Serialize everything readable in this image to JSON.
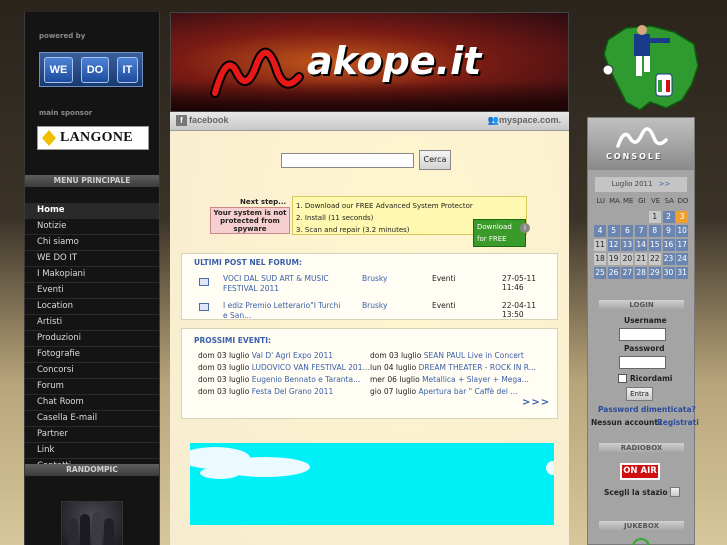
{
  "left": {
    "powered_by": "powered by",
    "wedoit": [
      "WE",
      "DO",
      "IT"
    ],
    "main_sponsor": "main sponsor",
    "sponsor_name": "LANGONE",
    "menu_title": "MENU PRINCIPALE",
    "menu": [
      "Home",
      "Notizie",
      "Chi siamo",
      "WE DO IT",
      "I Makopiani",
      "Eventi",
      "Location",
      "Artisti",
      "Produzioni",
      "Fotografie",
      "Concorsi",
      "Forum",
      "Chat Room",
      "Casella E-mail",
      "Partner",
      "Link",
      "Contatti"
    ],
    "randompic_title": "RANDOMPIC"
  },
  "banner": {
    "logo_text": "akope.it"
  },
  "social": {
    "facebook": "facebook",
    "myspace": "myspace.com."
  },
  "search": {
    "button": "Cerca",
    "value": ""
  },
  "ad": {
    "next_step": "Next step...",
    "warning": "Your system is not protected from spyware",
    "steps": [
      "1. Download our FREE Advanced System Protector",
      "2. Install (11 seconds)",
      "3. Scan and repair (3.2 minutes)"
    ],
    "download": "Download for FREE",
    "info": "i"
  },
  "forum": {
    "title": "ULTIMI POST NEL FORUM:",
    "rows": [
      {
        "title": "VOCI DAL SUD ART & MUSIC FESTIVAL 2011",
        "user": "Brusky",
        "category": "Eventi",
        "date": "27-05-11 11:46"
      },
      {
        "title": "I ediz Premio Letterario\"I Turchi e San...",
        "user": "Brusky",
        "category": "Eventi",
        "date": "22-04-11 13:50"
      }
    ]
  },
  "events": {
    "title": "PROSSIMI EVENTI:",
    "left": [
      {
        "date": "dom 03 luglio",
        "title": "Val D' Agri Expo 2011"
      },
      {
        "date": "dom 03 luglio",
        "title": "LUDOVICO VAN FESTIVAL 201..."
      },
      {
        "date": "dom 03 luglio",
        "title": "Eugenio Bennato e Taranta..."
      },
      {
        "date": "dom 03 luglio",
        "title": "Festa Del Grano 2011"
      }
    ],
    "right": [
      {
        "date": "dom 03 luglio",
        "title": "SEAN PAUL Live in Concert"
      },
      {
        "date": "lun 04 luglio",
        "title": "DREAM THEATER - ROCK IN R..."
      },
      {
        "date": "mer 06 luglio",
        "title": "Metallica + Slayer + Mega..."
      },
      {
        "date": "gio 07 luglio",
        "title": "Apertura bar \" Caffè del ..."
      }
    ],
    "more": ">>>"
  },
  "console": {
    "title": "CONSOLE",
    "month": "Luglio 2011",
    "next": ">>",
    "days": [
      "LU",
      "MA",
      "ME",
      "GI",
      "VE",
      "SA",
      "DO"
    ],
    "weeks": [
      [
        "",
        "",
        "",
        "",
        "1",
        "2",
        "3"
      ],
      [
        "4",
        "5",
        "6",
        "7",
        "8",
        "9",
        "10"
      ],
      [
        "11",
        "12",
        "13",
        "14",
        "15",
        "16",
        "17"
      ],
      [
        "18",
        "19",
        "20",
        "21",
        "22",
        "23",
        "24"
      ],
      [
        "25",
        "26",
        "27",
        "28",
        "29",
        "30",
        "31"
      ]
    ],
    "login_title": "LOGIN",
    "username_label": "Username",
    "password_label": "Password",
    "remember": "Ricordami",
    "login_button": "Entra",
    "forgot": "Password dimenticata?",
    "no_account": "Nessun account?",
    "register": "Registrati",
    "radiobox_title": "RADIOBOX",
    "onair": "ON AIR",
    "choose_station": "Scegli la stazione",
    "jukebox_title": "JUKEBOX"
  },
  "colors": {
    "accent_blue": "#3b5fa8",
    "calendar_blue": "#6a86b0",
    "today_orange": "#f0a030",
    "onair_red": "#d01010"
  }
}
